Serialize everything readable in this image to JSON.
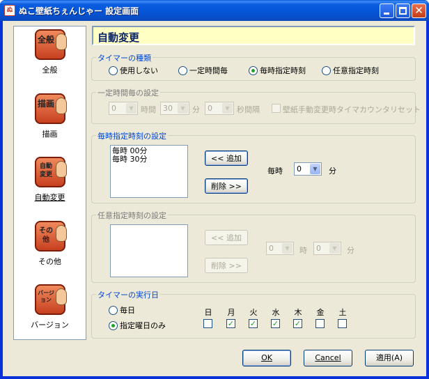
{
  "window": {
    "title": "ぬこ壁紙ちぇんじゃー 設定画面",
    "icon": "app-icon"
  },
  "titlebar": {
    "minimize": "minimize-icon",
    "maximize": "maximize-icon",
    "close_glyph": "✕"
  },
  "sidebar": {
    "items": [
      {
        "icon_text": "全般",
        "label": "全般"
      },
      {
        "icon_text": "描画",
        "label": "描画"
      },
      {
        "icon_text": "自動変更",
        "label": "自動変更",
        "active": true
      },
      {
        "icon_text": "その他",
        "label": "その他"
      },
      {
        "icon_text": "バージョン",
        "label": "バージョン"
      }
    ]
  },
  "heading": "自動変更",
  "timer_type": {
    "legend": "タイマーの種類",
    "options": [
      "使用しない",
      "一定時間毎",
      "毎時指定時刻",
      "任意指定時刻"
    ],
    "selected": "毎時指定時刻"
  },
  "interval": {
    "legend": "一定時間毎の設定",
    "hour_value": "0",
    "hour_label": "時間",
    "minute_value": "30",
    "minute_label": "分",
    "second_value": "0",
    "second_label": "秒間隔",
    "reset_label": "壁紙手動変更時タイマカウンタリセット"
  },
  "hourly": {
    "legend": "毎時指定時刻の設定",
    "list": [
      "毎時 00分",
      "毎時 30分"
    ],
    "add_label": "<< 追加",
    "delete_label": "削除 >>",
    "prefix": "毎時",
    "minute_value": "0",
    "suffix": "分"
  },
  "arbitrary": {
    "legend": "任意指定時刻の設定",
    "add_label": "<< 追加",
    "delete_label": "削除 >>",
    "hour_value": "0",
    "hour_label": "時",
    "minute_value": "0",
    "minute_label": "分"
  },
  "days": {
    "legend": "タイマーの実行日",
    "everyday": "毎日",
    "specific": "指定曜日のみ",
    "selected": "指定曜日のみ",
    "day_names": [
      "日",
      "月",
      "火",
      "水",
      "木",
      "金",
      "土"
    ],
    "checked": [
      false,
      true,
      true,
      true,
      true,
      false,
      false
    ]
  },
  "footer": {
    "ok": "OK",
    "cancel": "Cancel",
    "apply": "適用(A)"
  },
  "colors": {
    "legend_blue": "#0046d5",
    "heading_bg": "#ffffc3",
    "titlebar": "#0554d6"
  }
}
